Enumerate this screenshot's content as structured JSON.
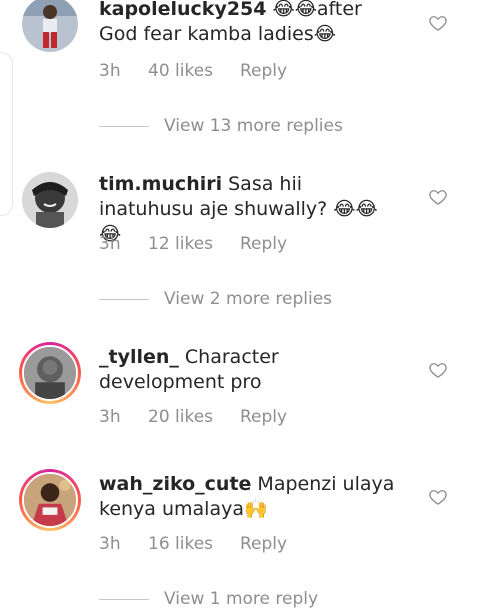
{
  "comments": [
    {
      "username": "kapolelucky254",
      "text": "😂😂after God fear kamba ladies😂",
      "time": "3h",
      "likes": "40 likes",
      "reply": "Reply",
      "view_more": "View 13 more replies"
    },
    {
      "username": "tim.muchiri",
      "text": "Sasa hii inatuhusu aje shuwally? 😂😂😂",
      "time": "3h",
      "likes": "12 likes",
      "reply": "Reply",
      "view_more": "View 2 more replies"
    },
    {
      "username": "_tyllen_",
      "text": "Character development pro",
      "time": "3h",
      "likes": "20 likes",
      "reply": "Reply",
      "view_more": ""
    },
    {
      "username": "wah_ziko_cute",
      "text": "Mapenzi ulaya kenya umalaya🙌",
      "time": "3h",
      "likes": "16 likes",
      "reply": "Reply",
      "view_more": "View 1 more reply"
    }
  ],
  "icons": {
    "like": "heart-outline-icon"
  },
  "colors": {
    "text": "#262626",
    "secondary": "#8e8e8e",
    "story_ring_start": "#d6249f",
    "story_ring_end": "#fdc468"
  }
}
